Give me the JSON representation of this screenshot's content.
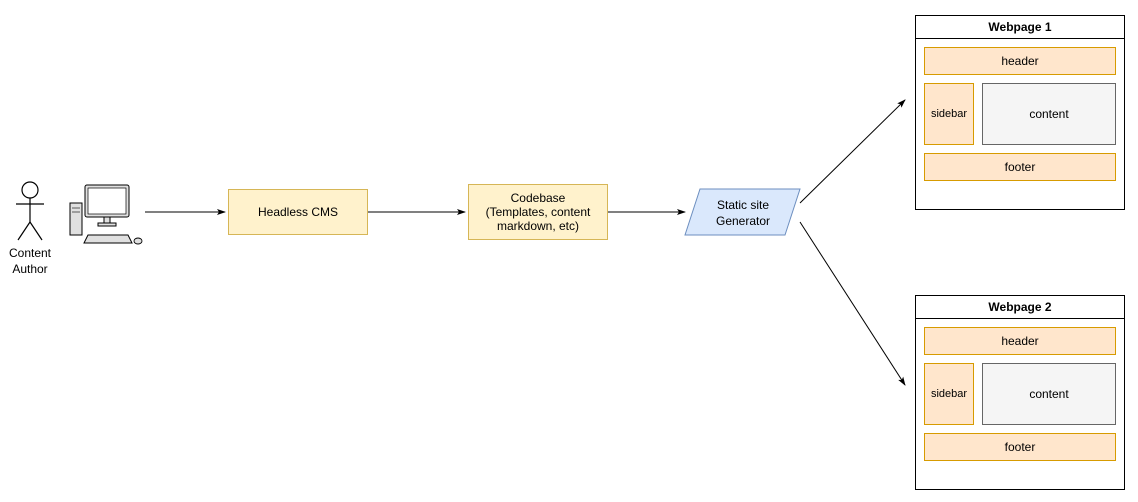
{
  "actor": {
    "label": "Content\nAuthor"
  },
  "nodes": {
    "cms": "Headless CMS",
    "codebase": "Codebase\n(Templates, content\nmarkdown, etc)",
    "ssg": "Static site\nGenerator"
  },
  "page1": {
    "title": "Webpage 1",
    "header": "header",
    "sidebar": "sidebar",
    "content": "content",
    "footer": "footer"
  },
  "page2": {
    "title": "Webpage 2",
    "header": "header",
    "sidebar": "sidebar",
    "content": "content",
    "footer": "footer"
  }
}
